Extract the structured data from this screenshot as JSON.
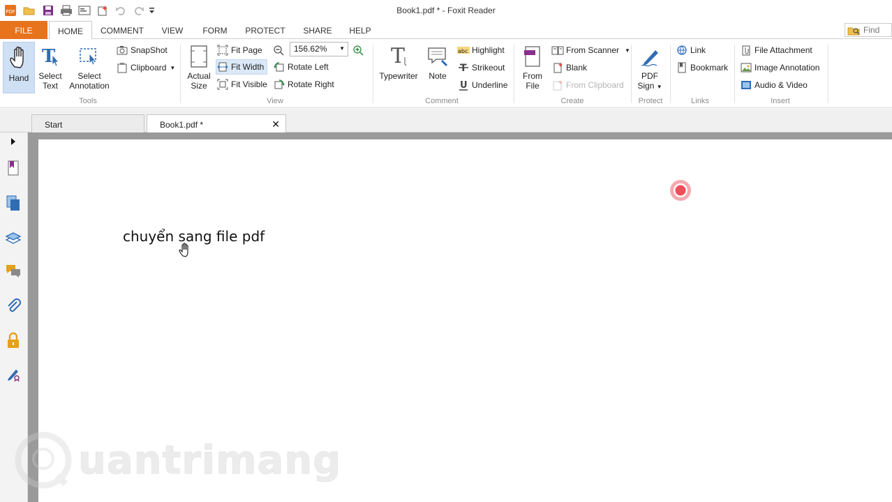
{
  "window": {
    "title": "Book1.pdf * - Foxit Reader"
  },
  "menu": {
    "tabs": [
      "FILE",
      "HOME",
      "COMMENT",
      "VIEW",
      "FORM",
      "PROTECT",
      "SHARE",
      "HELP"
    ],
    "active": "HOME",
    "find_placeholder": "Find"
  },
  "ribbon": {
    "tools": {
      "hand": "Hand",
      "select_text_1": "Select",
      "select_text_2": "Text",
      "select_annot_1": "Select",
      "select_annot_2": "Annotation",
      "snapshot": "SnapShot",
      "clipboard": "Clipboard",
      "label": "Tools"
    },
    "view": {
      "actual_1": "Actual",
      "actual_2": "Size",
      "fit_page": "Fit Page",
      "fit_width": "Fit Width",
      "fit_visible": "Fit Visible",
      "zoom": "156.62%",
      "rotate_left": "Rotate Left",
      "rotate_right": "Rotate Right",
      "label": "View"
    },
    "comment": {
      "typewriter": "Typewriter",
      "note": "Note",
      "highlight": "Highlight",
      "strikeout": "Strikeout",
      "underline": "Underline",
      "label": "Comment"
    },
    "create": {
      "from_file_1": "From",
      "from_file_2": "File",
      "from_scanner": "From Scanner",
      "blank": "Blank",
      "from_clipboard": "From Clipboard",
      "label": "Create"
    },
    "protect": {
      "pdf_sign_1": "PDF",
      "pdf_sign_2": "Sign",
      "label": "Protect"
    },
    "links": {
      "link": "Link",
      "bookmark": "Bookmark",
      "label": "Links"
    },
    "insert": {
      "file_attachment": "File Attachment",
      "image_annotation": "Image Annotation",
      "audio_video": "Audio & Video",
      "label": "Insert"
    }
  },
  "doc_tabs": [
    {
      "label": "Start"
    },
    {
      "label": "Book1.pdf *"
    }
  ],
  "document": {
    "text": "chuyển sang file pdf"
  },
  "watermark": "uantrimang",
  "colors": {
    "accent": "#e8731d",
    "active_btn": "#cfe0f5",
    "doc_bg": "#9a9a9a",
    "bookmark_icon": "#8b2f8f",
    "pages_icon": "#2f6db5",
    "lock_icon": "#e5a11a"
  }
}
